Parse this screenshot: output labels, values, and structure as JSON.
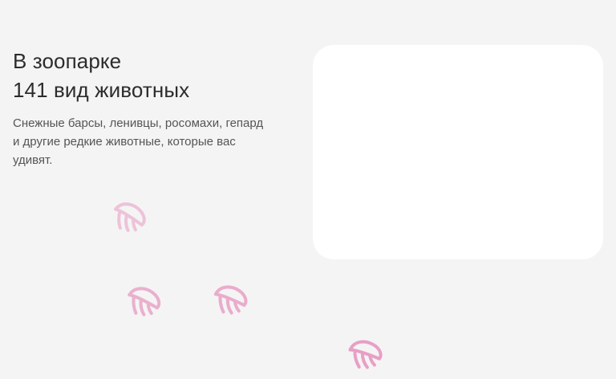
{
  "hero": {
    "title_line1": "В зоопарке",
    "title_line2": "141 вид животных",
    "description": "Снежные барсы, ленивцы, росомахи, гепард и другие редкие животные, которые вас удивят."
  },
  "decor": {
    "paw_icon": "paw-print-icon",
    "paw_color": "#e79ac2"
  },
  "colors": {
    "background": "#f4f4f4",
    "card": "#ffffff",
    "text_primary": "#2c2c2c",
    "text_secondary": "#555555"
  }
}
